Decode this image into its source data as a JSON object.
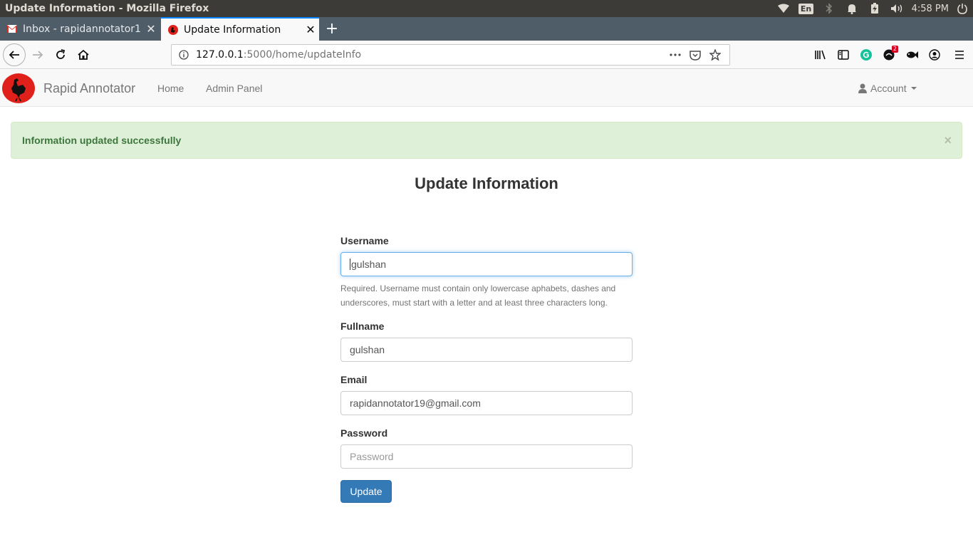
{
  "os": {
    "window_title": "Update Information - Mozilla Firefox",
    "lang": "En",
    "clock": "4:58 PM",
    "tray_icons": [
      "wifi-icon",
      "bluetooth-icon",
      "bell-icon",
      "battery-icon",
      "volume-icon",
      "power-icon"
    ]
  },
  "browser": {
    "tabs": [
      {
        "label": "Inbox - rapidannotator1",
        "favicon": "gmail-icon",
        "active": false
      },
      {
        "label": "Update Information",
        "favicon": "rooster-icon",
        "active": true
      }
    ],
    "url": {
      "host": "127.0.0.1",
      "rest": ":5000/home/updateInfo"
    },
    "extension_badge": "2"
  },
  "site": {
    "brand": "Rapid Annotator",
    "nav": [
      "Home",
      "Admin Panel"
    ],
    "account": "Account",
    "colors": {
      "primary": "#337ab7",
      "success_bg": "#dff0d8",
      "success_text": "#3c763d"
    }
  },
  "alert": {
    "message": "Information updated successfully",
    "close": "×"
  },
  "form": {
    "heading": "Update Information",
    "username": {
      "label": "Username",
      "value": "gulshan",
      "help": "Required. Username must contain only lowercase aphabets, dashes and underscores, must start with a letter and at least three characters long."
    },
    "fullname": {
      "label": "Fullname",
      "value": "gulshan"
    },
    "email": {
      "label": "Email",
      "value": "rapidannotator19@gmail.com"
    },
    "password": {
      "label": "Password",
      "placeholder": "Password"
    },
    "submit": "Update"
  }
}
